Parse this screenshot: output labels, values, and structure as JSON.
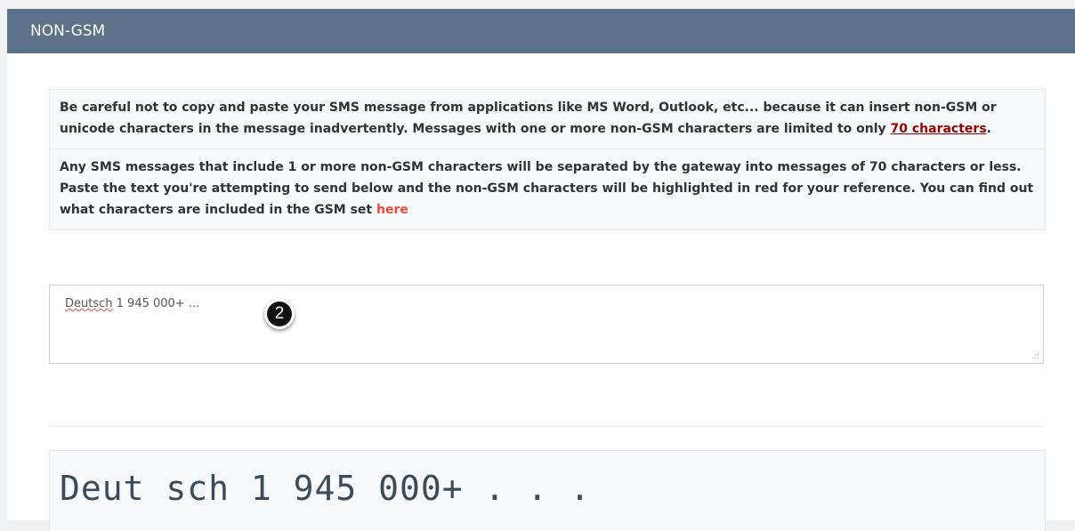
{
  "panel": {
    "title": "NON-GSM"
  },
  "notice": {
    "paragraph1_text": "Be careful not to copy and paste your SMS message from applications like MS Word, Outlook, etc... because it can insert non-GSM or unicode characters in the message inadvertently. Messages with one or more non-GSM characters are limited to only ",
    "paragraph1_link": "70 characters",
    "paragraph1_end": ".",
    "paragraph2_text": "Any SMS messages that include 1 or more non-GSM characters will be separated by the gateway into messages of 70 characters or less. Paste the text you're attempting to send below and the non-GSM characters will be highlighted in red for your reference. You can find out what characters are included in the GSM set ",
    "paragraph2_link": "here"
  },
  "message_input": {
    "word1": "Deutsch",
    "rest": " 1 945 000+ ..."
  },
  "step_badge": "2",
  "preview": {
    "text": "Deut sch 1 945 000+ . . ."
  },
  "icons": {
    "resize_grip": "resize-grip-icon"
  },
  "colors": {
    "header_bg": "#5d7189",
    "maroon_link": "#990000",
    "red_link": "#e74c3c"
  }
}
